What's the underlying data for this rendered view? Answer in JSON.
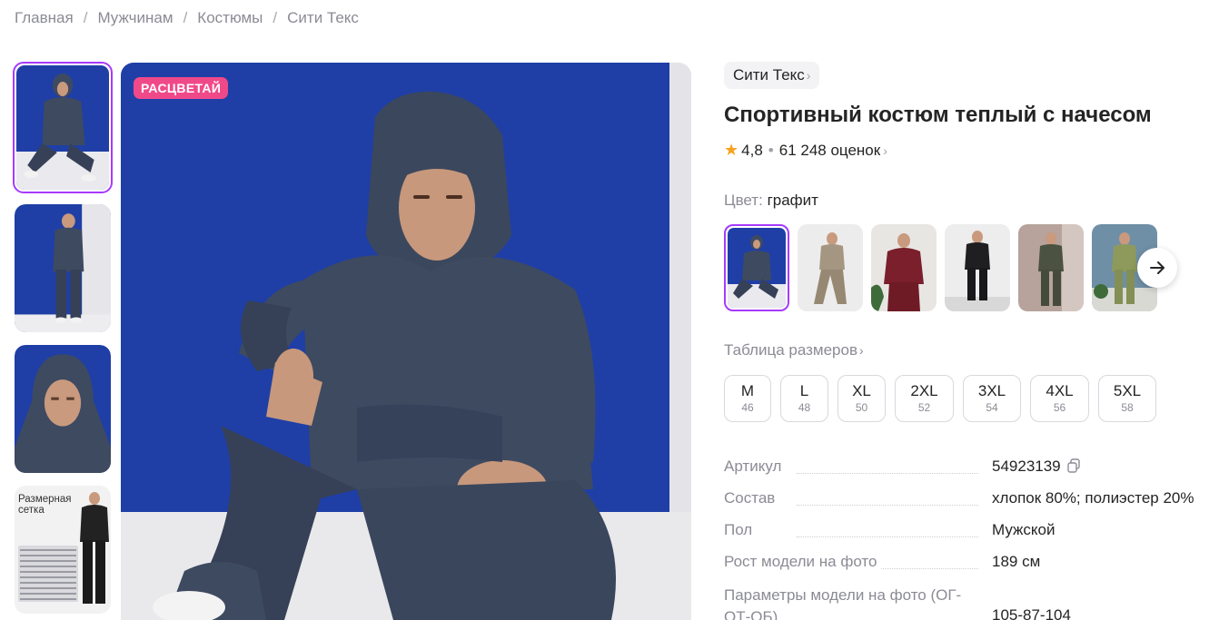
{
  "breadcrumb": [
    "Главная",
    "Мужчинам",
    "Костюмы",
    "Сити Текс"
  ],
  "gallery": {
    "promo_badge": "РАСЦВЕТАЙ",
    "size_chart_thumb_title": "Размерная сетка"
  },
  "product": {
    "brand": "Сити Текс",
    "title": "Спортивный костюм теплый с начесом",
    "rating": "4,8",
    "reviews": "61 248 оценок"
  },
  "color": {
    "label": "Цвет:",
    "value": "графит",
    "swatches": [
      "графит",
      "бежевый",
      "бордовый",
      "черный",
      "хаки",
      "оливковый"
    ]
  },
  "sizes": {
    "table_link": "Таблица размеров",
    "items": [
      {
        "name": "M",
        "ru": "46"
      },
      {
        "name": "L",
        "ru": "48"
      },
      {
        "name": "XL",
        "ru": "50"
      },
      {
        "name": "2XL",
        "ru": "52"
      },
      {
        "name": "3XL",
        "ru": "54"
      },
      {
        "name": "4XL",
        "ru": "56"
      },
      {
        "name": "5XL",
        "ru": "58"
      }
    ]
  },
  "specs": [
    {
      "key": "Артикул",
      "value": "54923139"
    },
    {
      "key": "Состав",
      "value": "хлопок 80%; полиэстер 20%"
    },
    {
      "key": "Пол",
      "value": "Мужской"
    },
    {
      "key": "Рост модели на фото",
      "value": "189 см"
    },
    {
      "key": "Параметры модели на фото (ОГ-ОТ-ОБ)",
      "value": "105-87-104"
    }
  ],
  "colors": {
    "accent": "#a73afd",
    "badge": "#f0498a",
    "star": "#f7a21d",
    "photo_blue": "#1f3fa6",
    "suit_graphite": "#3e4a60"
  }
}
